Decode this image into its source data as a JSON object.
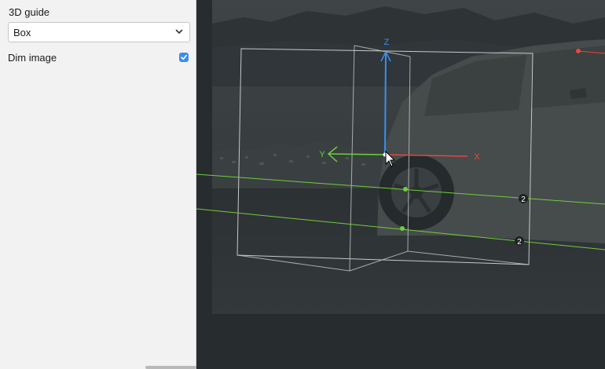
{
  "panel": {
    "guide_label": "3D guide",
    "guide_select": {
      "selected": "Box"
    },
    "dim_label": "Dim image",
    "dim_checked": true
  },
  "canvas": {
    "axis_labels": {
      "z": "Z",
      "y": "Y",
      "x": "X"
    },
    "guide_values": [
      "2",
      "2"
    ],
    "colors": {
      "z_axis": "#3a8ff0",
      "y_axis": "#6bd13a",
      "x_axis": "#e8483b",
      "guide_line": "#6fcf3a",
      "box": "#c8c8c8"
    }
  }
}
